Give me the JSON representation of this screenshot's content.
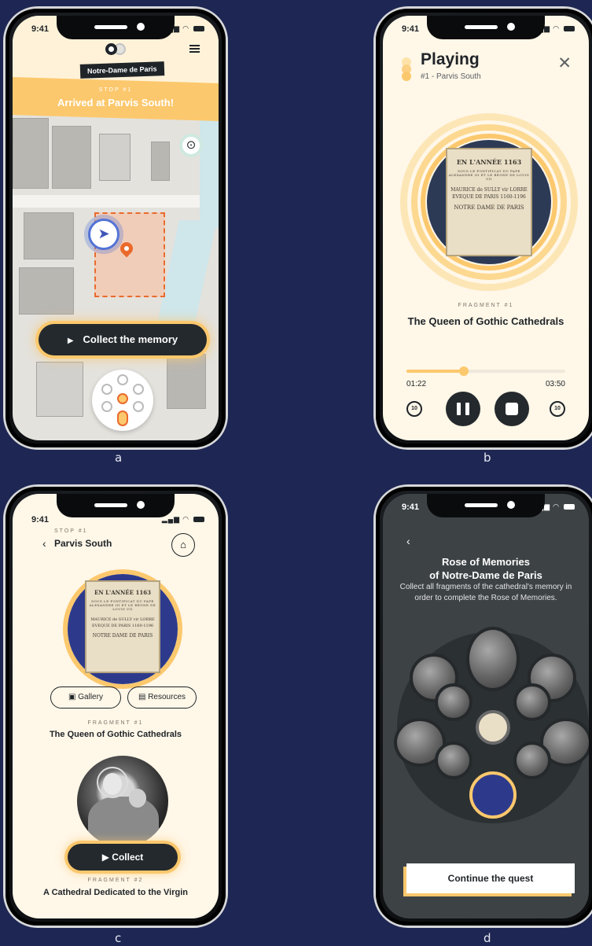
{
  "labels": {
    "a": "a",
    "b": "b",
    "c": "c",
    "d": "d"
  },
  "status": {
    "time": "9:41"
  },
  "screen_a": {
    "place": "Notre-Dame de Paris",
    "stop": "STOP #1",
    "arrived": "Arrived at Parvis South!",
    "collect_label": "Collect the memory",
    "icons": [
      "menu-icon",
      "locate-icon",
      "navigation-arrow-icon",
      "map-pin-icon",
      "play-icon",
      "rose-progress-icon"
    ]
  },
  "screen_b": {
    "title": "Playing",
    "subtitle": "#1 - Parvis South",
    "fragment": "FRAGMENT #1",
    "fragment_name": "The Queen of Gothic Cathedrals",
    "elapsed": "01:22",
    "duration": "03:50",
    "progress": 0.36,
    "skip_back": "10",
    "skip_forward": "10",
    "icons": [
      "close-icon",
      "pause-icon",
      "stop-icon",
      "rewind-10-icon",
      "forward-10-icon"
    ]
  },
  "plaque": {
    "line1": "EN L'ANNÉE 1163",
    "line2": "SOUS LE PONTIFICAT DU PAPE ALEXANDRE III ET LE RÈGNE DE LOUIS VII",
    "line3": "MAURICE de SULLY vir LORRE",
    "line4": "EVEQUE DE PARIS 1160-1196",
    "line5": "NOTRE DAME DE PARIS"
  },
  "screen_c": {
    "stop": "STOP #1",
    "title": "Parvis South",
    "gallery": "Gallery",
    "resources": "Resources",
    "fragment1": "FRAGMENT #1",
    "fragment1_name": "The Queen of Gothic Cathedrals",
    "collect_label": "Collect",
    "fragment2": "FRAGMENT #2",
    "fragment2_name": "A Cathedral Dedicated to the Virgin",
    "icons": [
      "back-chevron-icon",
      "map-icon",
      "gallery-icon",
      "resources-icon",
      "play-icon"
    ]
  },
  "screen_d": {
    "title_line1": "Rose of Memories",
    "title_line2": "of Notre-Dame de Paris",
    "description": "Collect all fragments of the cathedral's memory in order to complete the Rose of Memories.",
    "button": "Continue the quest",
    "icons": [
      "back-chevron-icon",
      "rose-window-icon"
    ]
  },
  "colors": {
    "background": "#1e2653",
    "accent": "#fcc86d",
    "dark": "#24292d",
    "cream": "#fff7e8",
    "orange": "#ea6a2c",
    "blue": "#5473d6"
  }
}
